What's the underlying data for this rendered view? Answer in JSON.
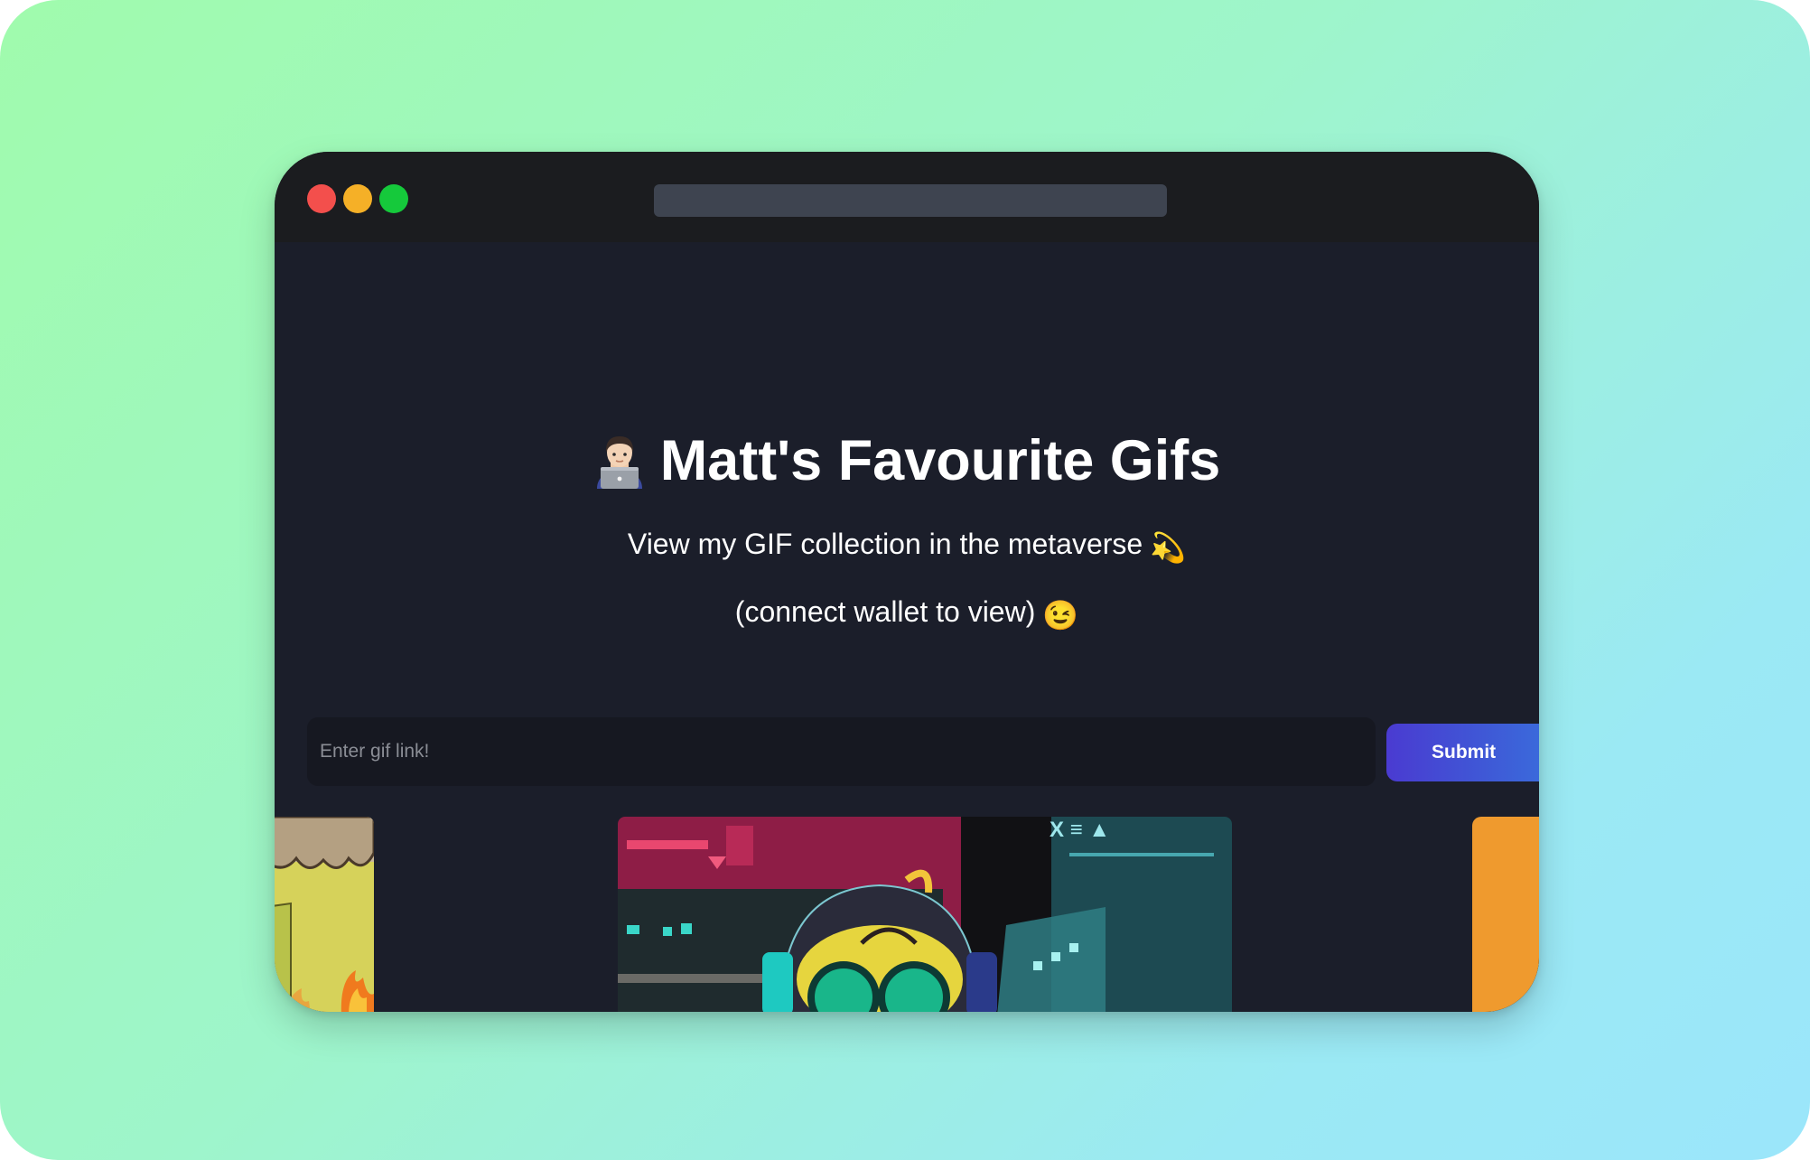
{
  "page": {
    "title": "Matt's Favourite Gifs",
    "subtitle": "View my GIF collection in the metaverse",
    "subtitle_emoji": "💫",
    "connect_hint": "(connect wallet to view)",
    "connect_emoji": "😉",
    "title_emoji": "man-technologist-icon"
  },
  "form": {
    "input_placeholder": "Enter gif link!",
    "input_value": "",
    "submit_label": "Submit"
  },
  "colors": {
    "background": "#1b1e2a",
    "titlebar": "#1b1c1f",
    "button_start": "#4a3bd1",
    "button_end": "#3a6cdc"
  },
  "gifs": [
    {
      "name": "gif-thumbnail-cartoon-fire"
    },
    {
      "name": "gif-thumbnail-cyber-character"
    },
    {
      "name": "gif-thumbnail-orange"
    }
  ]
}
